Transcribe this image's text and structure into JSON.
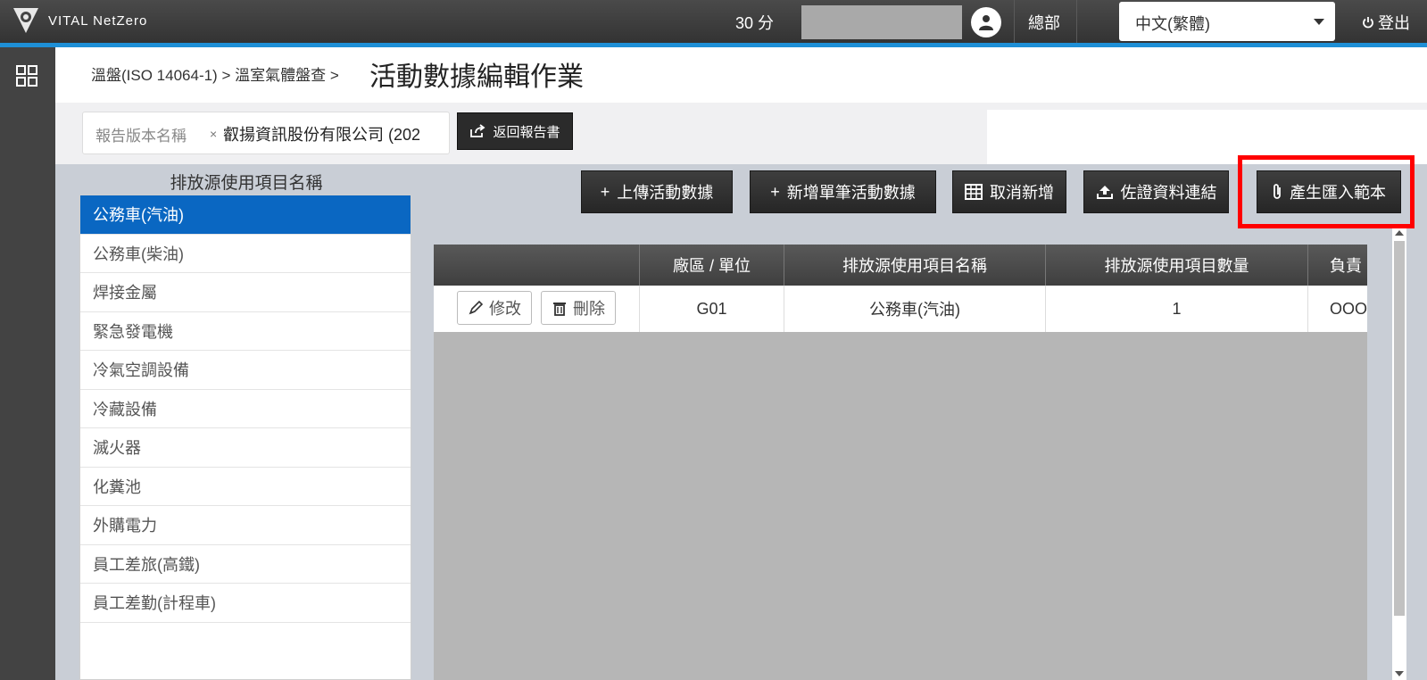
{
  "app": {
    "logo_text": "VITAL NetZero"
  },
  "topbar": {
    "points": "30 分",
    "org": "總部",
    "language": "中文(繁體)",
    "logout": "登出"
  },
  "breadcrumb": "溫盤(ISO 14064-1) > 溫室氣體盤查 >",
  "page_title": "活動數據編輯作業",
  "report": {
    "label": "報告版本名稱",
    "clear": "×",
    "value": "叡揚資訊股份有限公司 (202",
    "return_button": "返回報告書"
  },
  "source_list": {
    "title": "排放源使用項目名稱",
    "items": [
      "公務車(汽油)",
      "公務車(柴油)",
      "焊接金屬",
      "緊急發電機",
      "冷氣空調設備",
      "冷藏設備",
      "滅火器",
      "化糞池",
      "外購電力",
      "員工差旅(高鐵)",
      "員工差勤(計程車)"
    ]
  },
  "actions": {
    "upload": "上傳活動數據",
    "add_single": "新增單筆活動數據",
    "cancel_add": "取消新增",
    "evidence_link": "佐證資料連結",
    "generate_template": "產生匯入範本"
  },
  "table": {
    "headers": [
      "",
      "廠區 / 單位",
      "排放源使用項目名稱",
      "排放源使用項目數量",
      "負責"
    ],
    "rows": [
      {
        "edit": "修改",
        "delete": "刪除",
        "site": "G01",
        "item": "公務車(汽油)",
        "qty": "1",
        "owner": "OOO"
      }
    ]
  },
  "colors": {
    "accent": "#1e8fd6",
    "active": "#0a67c2",
    "highlight": "#ff0000"
  }
}
